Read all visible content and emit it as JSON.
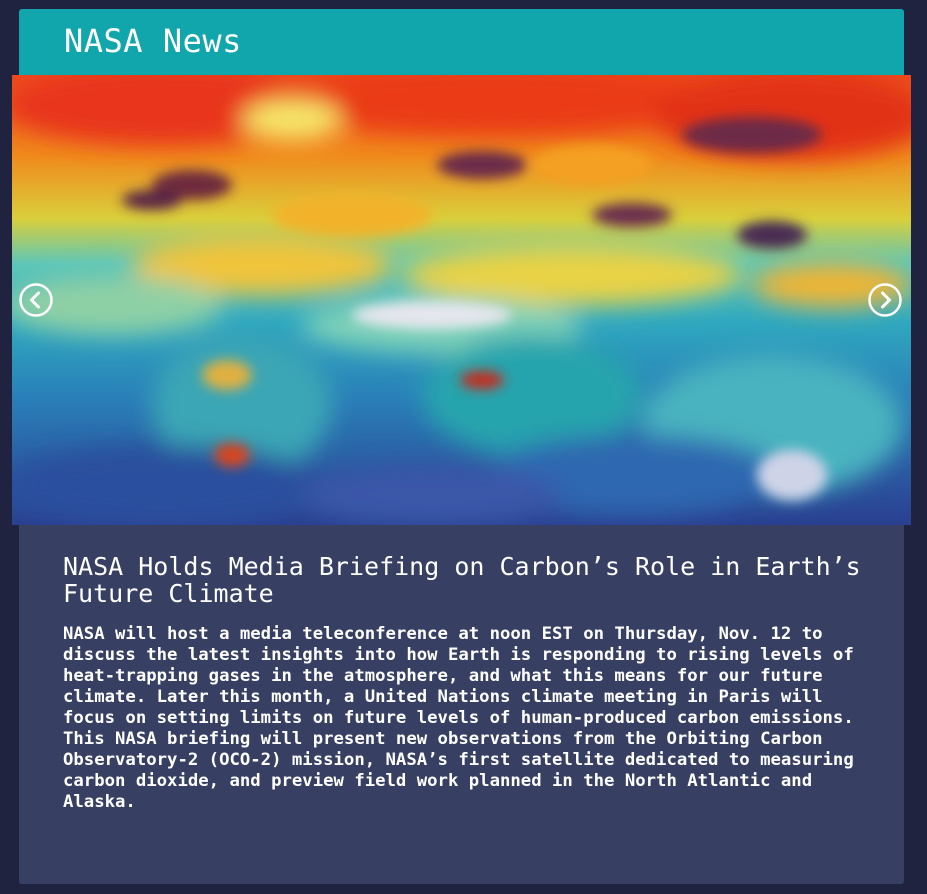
{
  "widget": {
    "title": "NASA News"
  },
  "carousel": {
    "prev_icon": "chevron-left-circle-icon",
    "next_icon": "chevron-right-circle-icon",
    "image_subject": "global carbon dioxide map"
  },
  "article": {
    "title": "NASA Holds Media Briefing on Carbon’s Role in Earth’s Future Climate",
    "body": "NASA will host a media teleconference at noon EST on Thursday, Nov. 12 to discuss the latest insights into how Earth is responding to rising levels of heat-trapping gases in the atmosphere, and what this means for our future climate. Later this month, a United Nations climate meeting in Paris will focus on setting limits on future levels of human-produced carbon emissions. This NASA briefing will present new observations from the Orbiting Carbon Observatory-2 (OCO-2) mission, NASA’s first satellite dedicated to measuring carbon dioxide, and preview field work planned in the North Atlantic and Alaska."
  },
  "colors": {
    "page_background": "#1f2340",
    "header_background": "#11a6ab",
    "card_background": "#374063",
    "text": "#ffffff"
  }
}
